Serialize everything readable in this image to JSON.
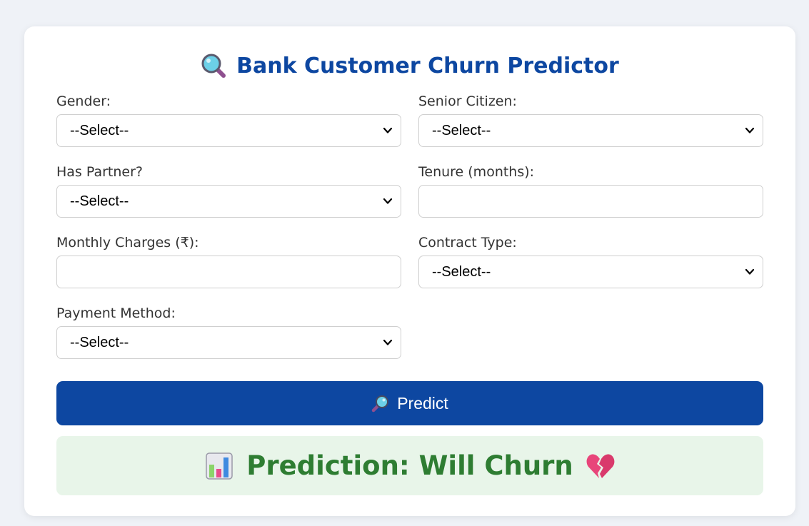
{
  "header": {
    "title": "Bank Customer Churn Predictor",
    "icon": "magnifying-glass-icon"
  },
  "form": {
    "gender": {
      "label": "Gender:",
      "value": "--Select--"
    },
    "senior_citizen": {
      "label": "Senior Citizen:",
      "value": "--Select--"
    },
    "has_partner": {
      "label": "Has Partner?",
      "value": "--Select--"
    },
    "tenure": {
      "label": "Tenure (months):",
      "value": ""
    },
    "monthly_charges": {
      "label": "Monthly Charges (₹):",
      "value": ""
    },
    "contract_type": {
      "label": "Contract Type:",
      "value": "--Select--"
    },
    "payment_method": {
      "label": "Payment Method:",
      "value": "--Select--"
    }
  },
  "predict_button": {
    "label": "Predict",
    "icon": "magnifying-glass-icon"
  },
  "result": {
    "text": "Prediction: Will Churn",
    "icon_left": "bar-chart-icon",
    "icon_right": "broken-heart-icon"
  },
  "colors": {
    "accent": "#0d47a1",
    "result_text": "#2e7d32",
    "result_bg": "#e8f5e9",
    "page_bg": "#eff2f7"
  }
}
